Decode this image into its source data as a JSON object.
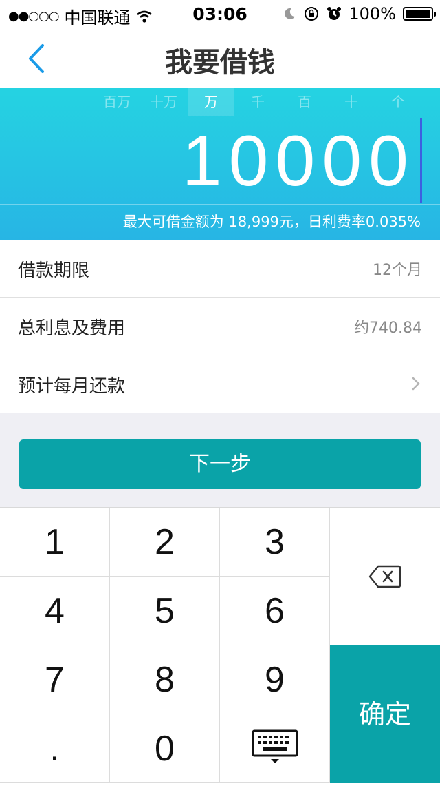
{
  "status": {
    "signal": "●●○○○",
    "carrier": "中国联通",
    "time": "03:06",
    "battery": "100%"
  },
  "nav": {
    "title": "我要借钱"
  },
  "units": [
    "百万",
    "十万",
    "万",
    "千",
    "百",
    "十",
    "个"
  ],
  "active_unit": "万",
  "amount": "10000",
  "limit_text": "最大可借金额为 18,999元，日利费率0.035%",
  "rows": [
    {
      "label": "借款期限",
      "value": "12个月"
    },
    {
      "label": "总利息及费用",
      "value": "约740.84"
    },
    {
      "label": "预计每月还款",
      "value": ""
    }
  ],
  "next_button": "下一步",
  "keys": [
    "1",
    "2",
    "3",
    "4",
    "5",
    "6",
    "7",
    "8",
    "9",
    ".",
    "0"
  ],
  "confirm_label": "确定",
  "colors": {
    "accent": "#0aa3a8",
    "panel_top": "#25d3e2",
    "panel_bottom": "#27b5e4"
  }
}
